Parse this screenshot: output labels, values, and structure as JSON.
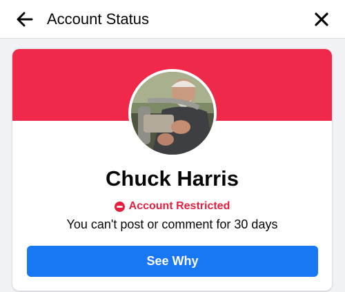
{
  "header": {
    "title": "Account Status",
    "back_icon": "arrow-left-icon",
    "close_icon": "close-icon"
  },
  "profile": {
    "name": "Chuck Harris",
    "avatar_icon": "profile-photo"
  },
  "status": {
    "label": "Account Restricted",
    "icon": "restricted-icon",
    "message": "You can't post or comment for 30 days"
  },
  "actions": {
    "see_why_label": "See Why"
  },
  "colors": {
    "banner": "#f02849",
    "status": "#e41e3f",
    "button": "#1877f2"
  }
}
